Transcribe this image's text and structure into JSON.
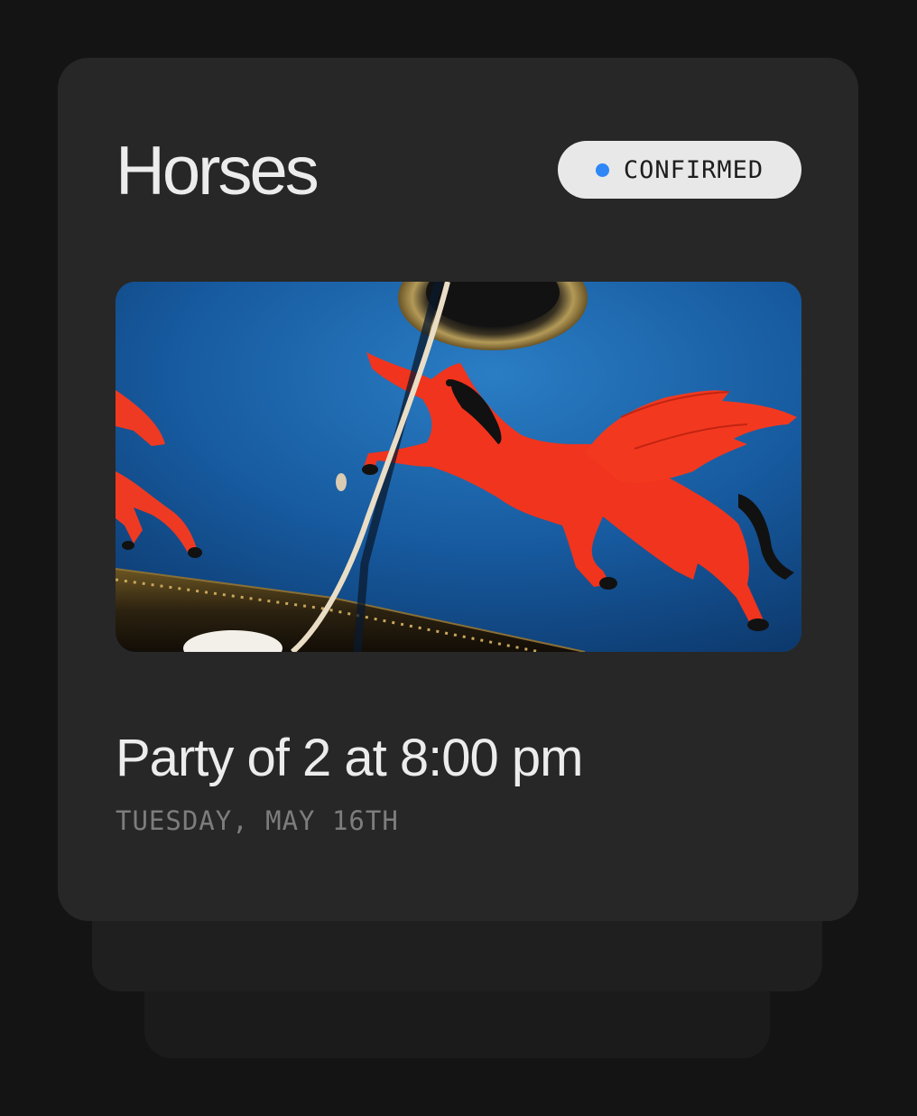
{
  "reservation": {
    "title": "Horses",
    "status": {
      "label": "CONFIRMED",
      "dot_color": "#2f86f6"
    },
    "photo": {
      "alt": "Ceiling painting of a red winged horse on a blue background"
    },
    "party_line": "Party of 2 at 8:00 pm",
    "date": "TUESDAY, MAY 16TH"
  },
  "colors": {
    "background": "#141414",
    "card": "#272727",
    "badge_background": "#e8e8e8",
    "title_text": "#ececec",
    "date_text": "#7d7d7d"
  }
}
